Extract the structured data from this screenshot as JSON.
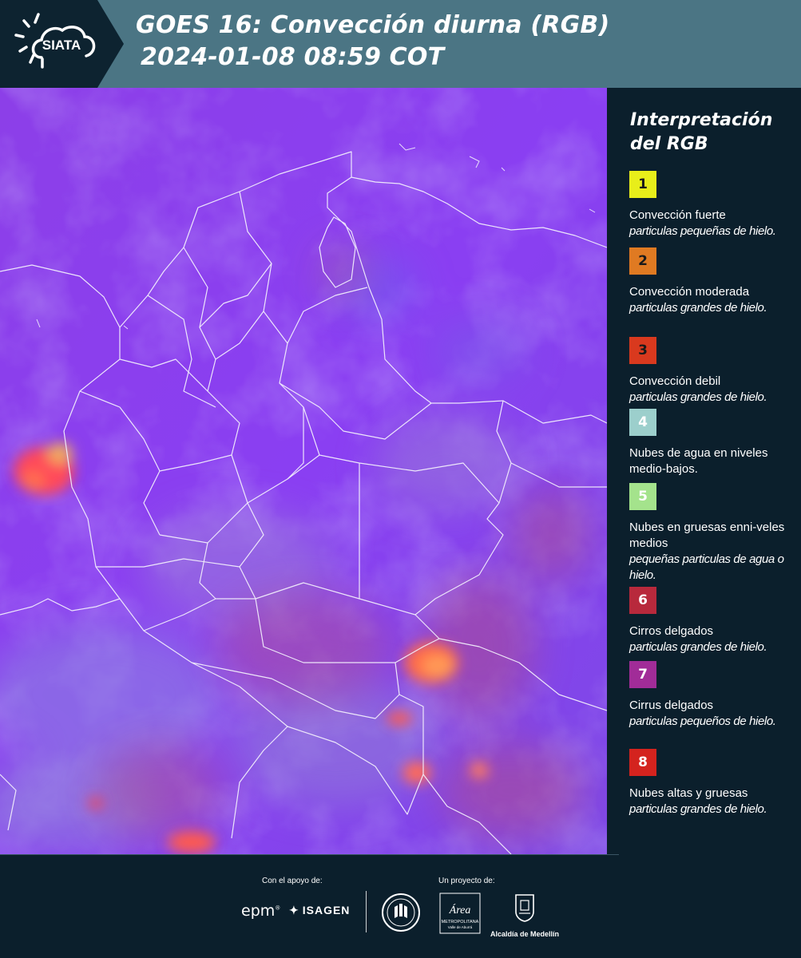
{
  "header": {
    "logo_text": "SIATA",
    "title_line1": "GOES 16: Convección diurna (RGB)",
    "title_line2": "2024-01-08 08:59 COT"
  },
  "legend": {
    "title": "Interpretación del RGB",
    "items": [
      {
        "num": "1",
        "color": "#e8ee1a",
        "text_color": "#1a1a1a",
        "name": "Convección fuerte",
        "desc": "particulas pequeñas de hielo."
      },
      {
        "num": "2",
        "color": "#e07a22",
        "text_color": "#1a1a1a",
        "name": "Convección moderada",
        "desc": "particulas grandes de hielo."
      },
      {
        "num": "3",
        "color": "#d9391e",
        "text_color": "#1a1a1a",
        "name": "Convección debil",
        "desc": "particulas grandes de hielo."
      },
      {
        "num": "4",
        "color": "#9ccfcc",
        "text_color": "#ffffff",
        "name": "Nubes de agua en niveles medio-bajos.",
        "desc": ""
      },
      {
        "num": "5",
        "color": "#a4e38c",
        "text_color": "#ffffff",
        "name": "Nubes en gruesas enni-veles medios",
        "desc": "pequeñas particulas de agua o hielo."
      },
      {
        "num": "6",
        "color": "#b8293c",
        "text_color": "#ffffff",
        "name": "Cirros delgados",
        "desc": "particulas grandes de hielo."
      },
      {
        "num": "7",
        "color": "#a12c98",
        "text_color": "#ffffff",
        "name": "Cirrus delgados",
        "desc": "particulas pequeños de hielo."
      },
      {
        "num": "8",
        "color": "#d4231e",
        "text_color": "#ffffff",
        "name": "Nubes altas y gruesas",
        "desc": "particulas grandes de hielo."
      }
    ]
  },
  "footer": {
    "support_caption": "Con el apoyo de:",
    "project_caption": "Un proyecto de:",
    "epm_text": "epm",
    "isagen_text": "ISAGEN",
    "metropolitana_title": "Área",
    "metropolitana_text": "METROPOLITANA",
    "metropolitana_sub": "Valle de Aburrá",
    "alcaldia_text": "Alcaldía de Medellín"
  },
  "colors": {
    "header_bg": "#4b7584",
    "logo_bg": "#0d2330",
    "panel_bg": "#0b1f2c",
    "map_base": "#8a3ef0"
  }
}
